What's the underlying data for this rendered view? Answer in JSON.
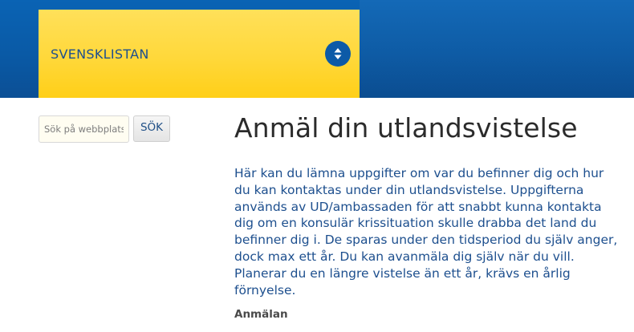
{
  "header": {
    "site_title": "SVENSKLISTAN",
    "menu_toggle_icon": "chevron-up-down-icon",
    "colors": {
      "blue": "#0a5aa6",
      "yellow": "#ffd83a"
    }
  },
  "search": {
    "placeholder": "Sök på webbplats",
    "button_label": "SÖK"
  },
  "main": {
    "title": "Anmäl din utlandsvistelse",
    "intro": "Här kan du lämna uppgifter om var du befinner dig och hur du kan kontaktas under din utlandsvistelse. Uppgifterna används av UD/ambassaden för att snabbt kunna kontakta dig om en konsulär krissituation skulle drabba det land du befinner dig i. De sparas under den tidsperiod du själv anger, dock max ett år. Du kan avanmäla dig själv när du vill. Planerar du en längre vistelse än ett år, krävs en årlig förnyelse.",
    "subheading": "Anmälan"
  }
}
